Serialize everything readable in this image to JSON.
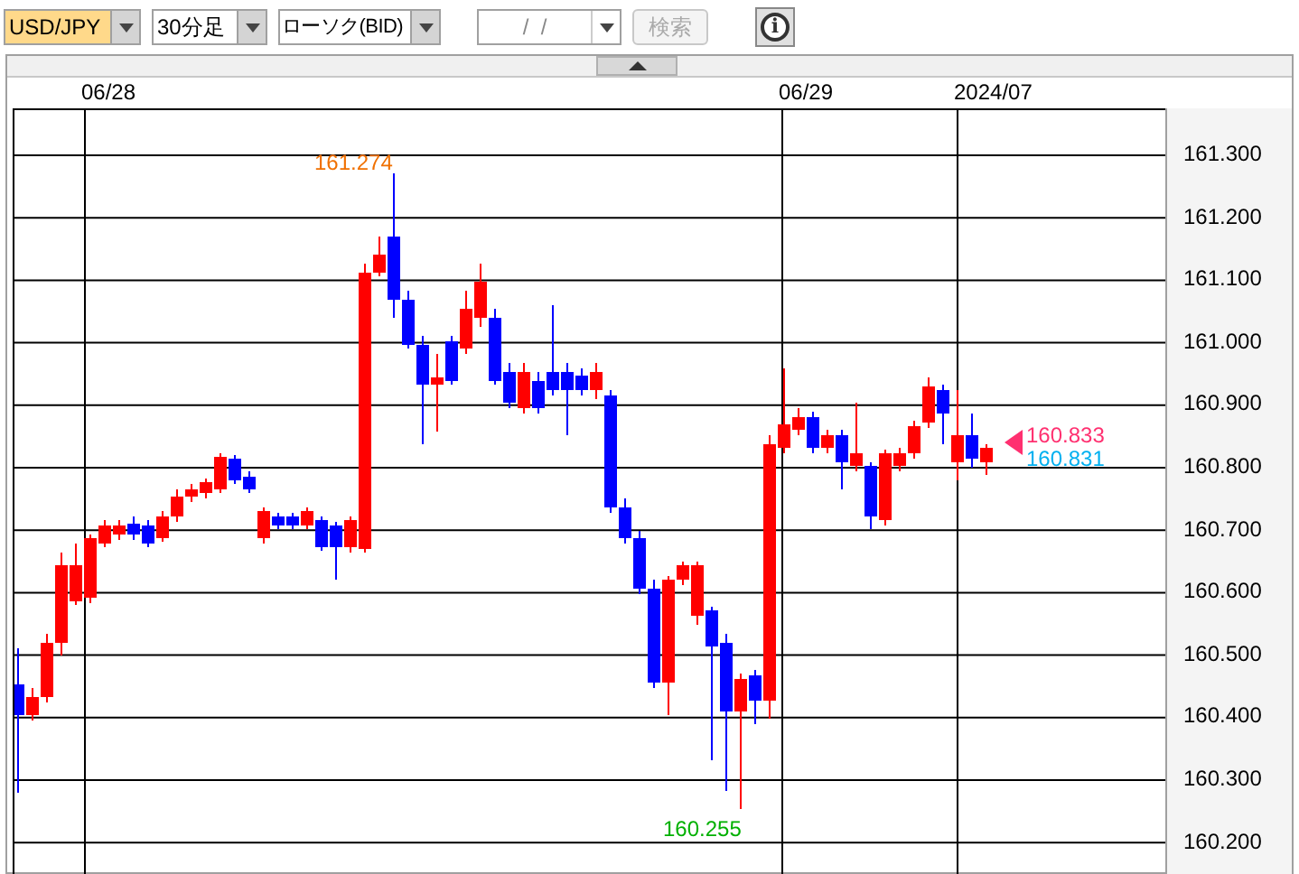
{
  "toolbar": {
    "symbol": {
      "value": "USD/JPY",
      "highlighted": true
    },
    "timeframe": {
      "value": "30分足"
    },
    "chart_type": {
      "value": "ローソク(BID)"
    },
    "date_field": {
      "placeholder": "/  /"
    },
    "search_button": {
      "label": "検索",
      "disabled": true
    },
    "info_button": {
      "label": "i"
    }
  },
  "chart": {
    "date_labels": [
      "06/28",
      "06/29",
      "2024/07"
    ],
    "y_axis_labels": [
      "161.300",
      "161.200",
      "161.100",
      "161.000",
      "160.900",
      "160.800",
      "160.700",
      "160.600",
      "160.500",
      "160.400",
      "160.300",
      "160.200"
    ],
    "high_label": "161.274",
    "low_label": "160.255",
    "bid_label": "160.833",
    "ask_label": "160.831"
  }
}
